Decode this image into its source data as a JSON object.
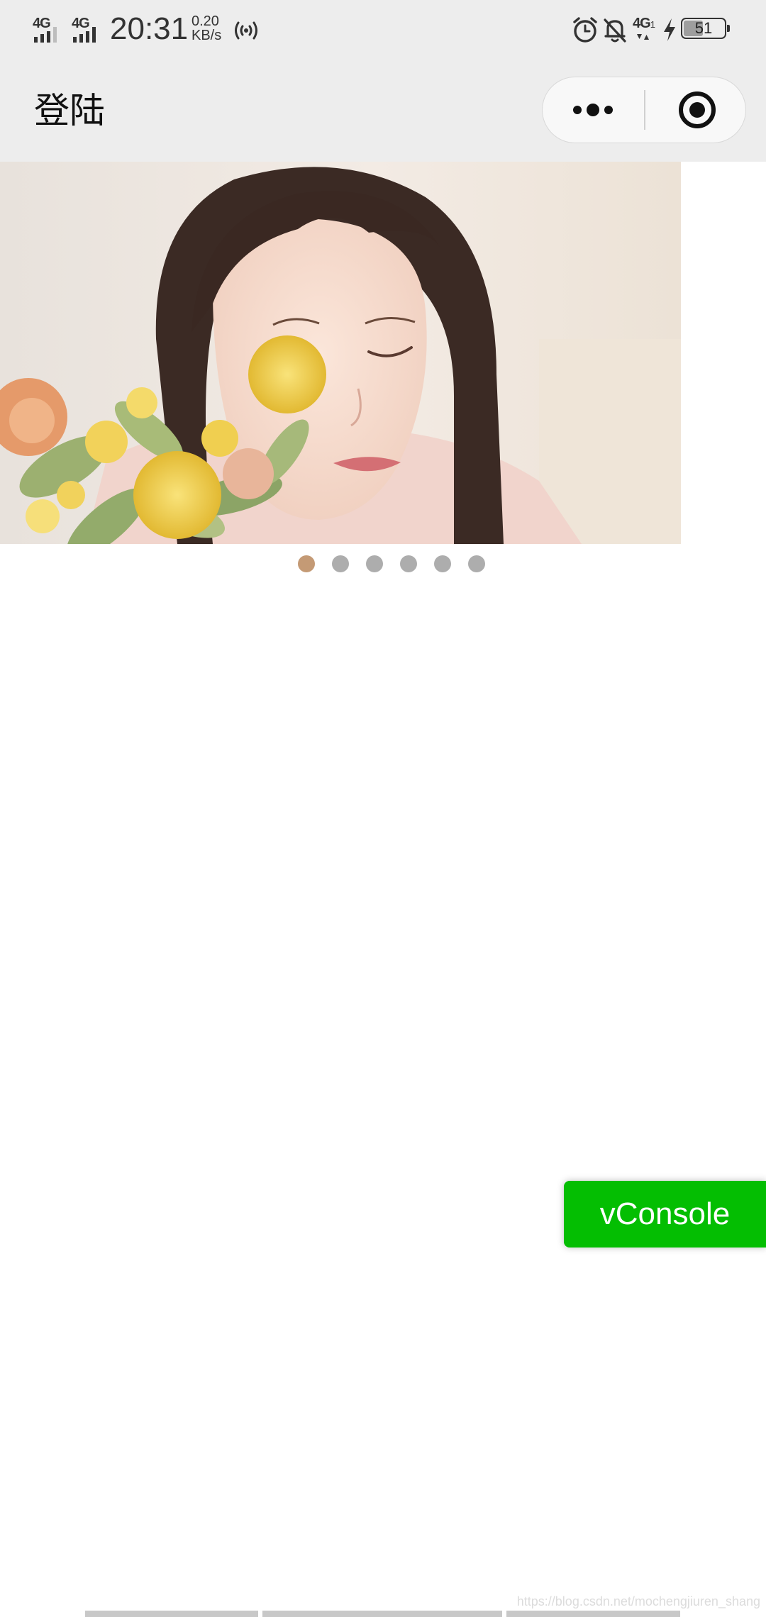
{
  "status_bar": {
    "sim1_network": "4G",
    "sim2_network": "4G",
    "time": "20:31",
    "speed_value": "0.20",
    "speed_unit": "KB/s",
    "right_network": "4G",
    "right_network_sub": "1",
    "battery_level": "51",
    "icons": [
      "signal-icon",
      "hotspot-icon",
      "alarm-icon",
      "bell-off-icon",
      "charging-icon",
      "battery-icon"
    ]
  },
  "nav": {
    "title": "登陆",
    "more_icon": "more-dots-icon",
    "close_icon": "target-close-icon"
  },
  "carousel": {
    "slide_count": 6,
    "active_index": 0,
    "active_dot_color": "#c49a75",
    "inactive_dot_color": "#adadad"
  },
  "vconsole": {
    "label": "vConsole",
    "color": "#04be02"
  },
  "watermark": "https://blog.csdn.net/mochengjiuren_shang"
}
